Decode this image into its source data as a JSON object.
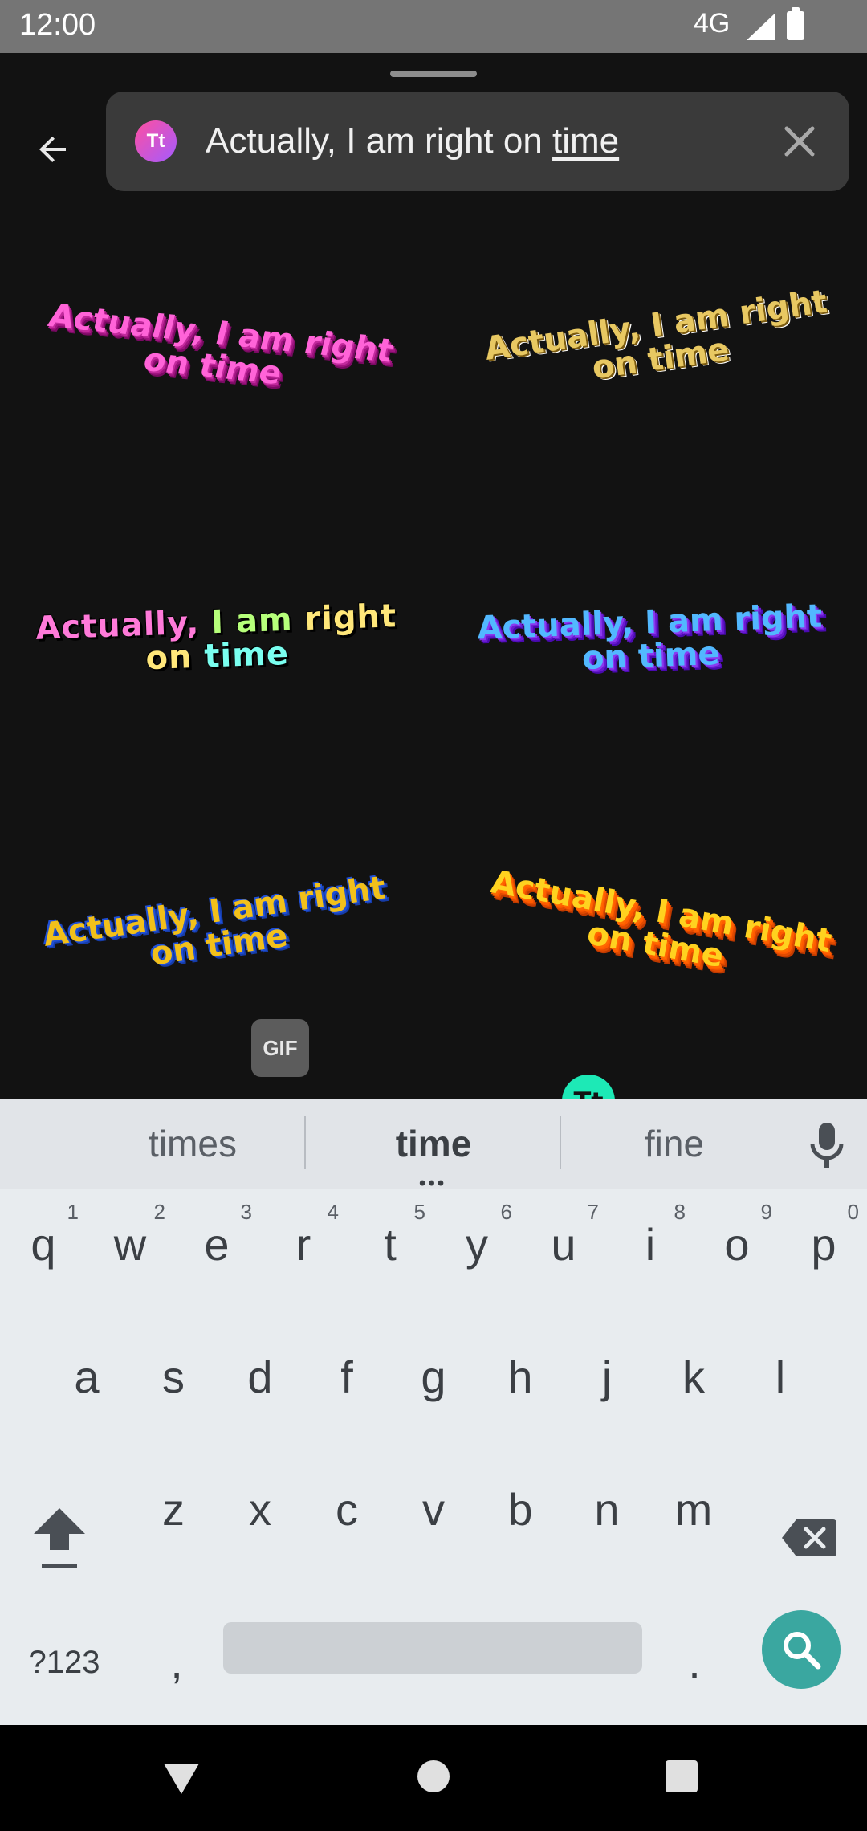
{
  "status_bar": {
    "time": "12:00",
    "network": "4G"
  },
  "search": {
    "app_icon_label": "Tt",
    "query_main": "Actually, I am right on ",
    "query_underlined": "time"
  },
  "stickers": [
    {
      "text": "Actually, I am right on time"
    },
    {
      "text": "Actually, I am right on time"
    },
    {
      "text": "Actually, I am right on time"
    },
    {
      "text": "Actually, I am right on time"
    },
    {
      "text": "Actually, I am right on time"
    },
    {
      "text": "Actually, I am right on time"
    }
  ],
  "sticker3_parts": [
    "Actually, ",
    "I am ",
    "right on ",
    "time"
  ],
  "categories": {
    "gif_label": "GIF",
    "text_label": "Tt"
  },
  "suggestions": {
    "left": "times",
    "middle": "time",
    "right": "fine"
  },
  "keyboard": {
    "row1": [
      {
        "k": "q",
        "h": "1"
      },
      {
        "k": "w",
        "h": "2"
      },
      {
        "k": "e",
        "h": "3"
      },
      {
        "k": "r",
        "h": "4"
      },
      {
        "k": "t",
        "h": "5"
      },
      {
        "k": "y",
        "h": "6"
      },
      {
        "k": "u",
        "h": "7"
      },
      {
        "k": "i",
        "h": "8"
      },
      {
        "k": "o",
        "h": "9"
      },
      {
        "k": "p",
        "h": "0"
      }
    ],
    "row2": [
      "a",
      "s",
      "d",
      "f",
      "g",
      "h",
      "j",
      "k",
      "l"
    ],
    "row3": [
      "z",
      "x",
      "c",
      "v",
      "b",
      "n",
      "m"
    ],
    "symbols_label": "?123",
    "comma_label": ",",
    "period_label": "."
  },
  "colors": {
    "accent": "#3aa7a0",
    "text_app_green": "#1de9b6",
    "keyboard_bg": "#e8ecef"
  }
}
